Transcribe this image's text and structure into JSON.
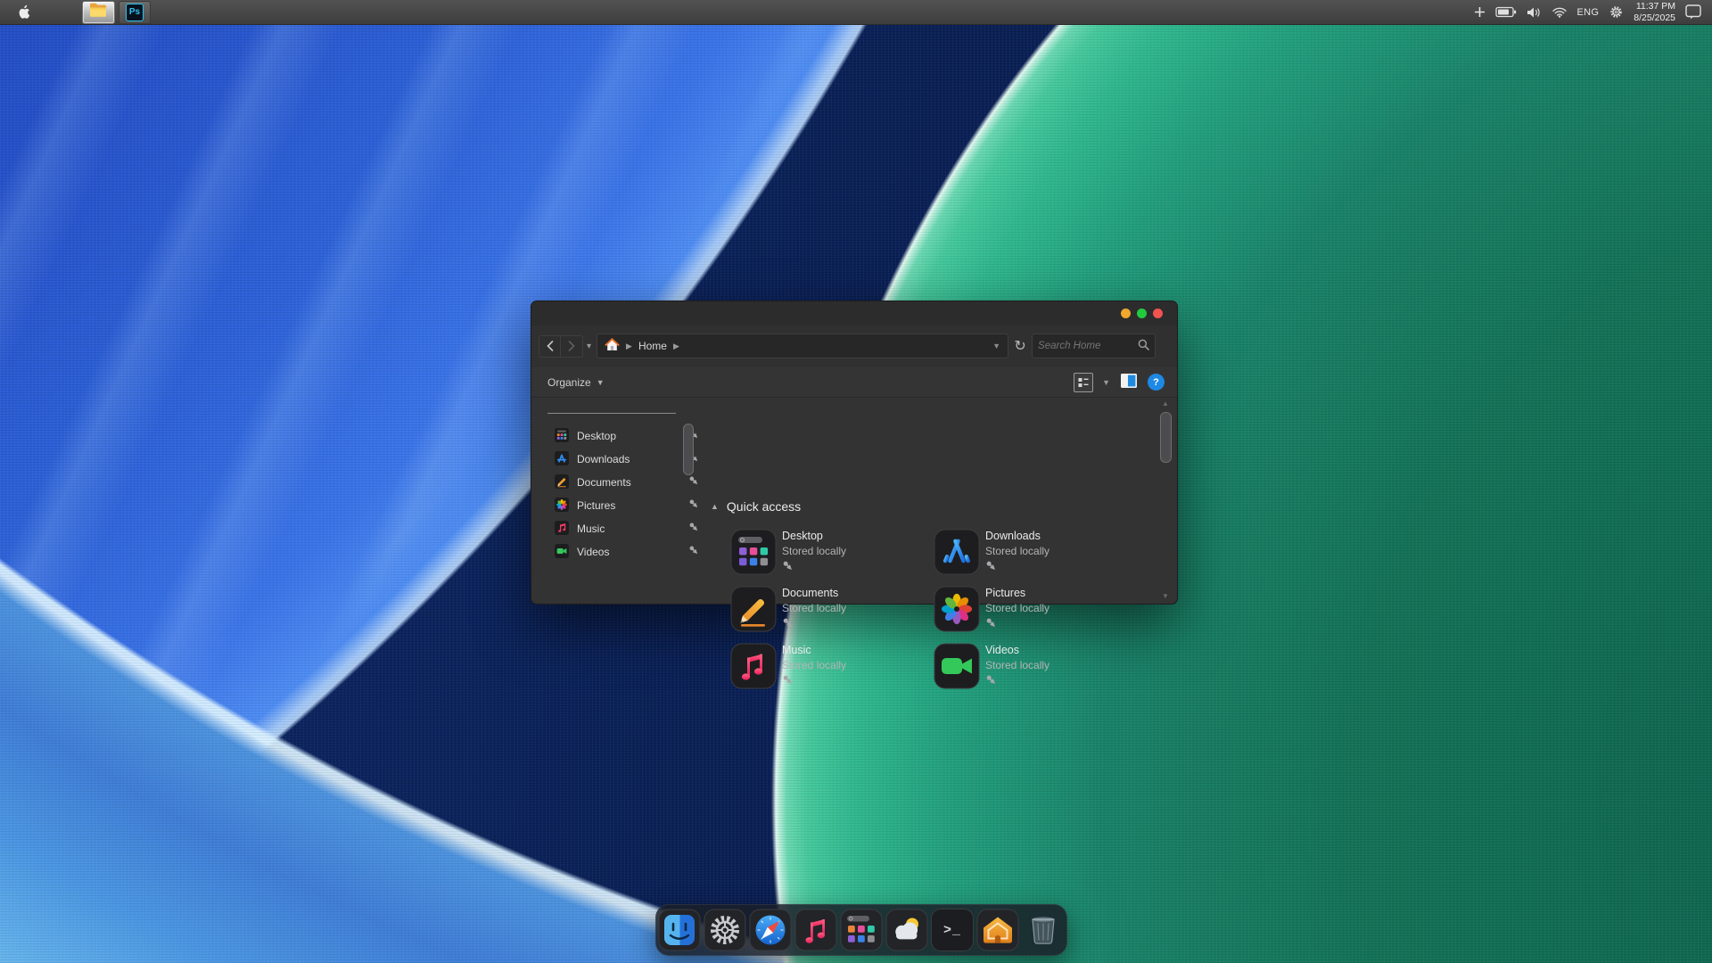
{
  "menubar": {
    "taskbar": {
      "photoshop_label": "Ps"
    },
    "status": {
      "language": "ENG",
      "time": "11:37 PM",
      "date": "8/25/2025"
    }
  },
  "window": {
    "nav": {
      "breadcrumb_root": "Home",
      "search_placeholder": "Search Home"
    },
    "toolbar": {
      "organize_label": "Organize"
    },
    "sidebar": {
      "items": [
        {
          "label": "Desktop",
          "icon": "launchpad-icon"
        },
        {
          "label": "Downloads",
          "icon": "app-store-icon"
        },
        {
          "label": "Documents",
          "icon": "pencil-icon"
        },
        {
          "label": "Pictures",
          "icon": "photos-flower-icon"
        },
        {
          "label": "Music",
          "icon": "music-note-icon"
        },
        {
          "label": "Videos",
          "icon": "video-camera-icon"
        }
      ]
    },
    "content": {
      "section_title": "Quick access",
      "tiles": [
        {
          "title": "Desktop",
          "subtitle": "Stored locally",
          "icon": "launchpad-icon"
        },
        {
          "title": "Downloads",
          "subtitle": "Stored locally",
          "icon": "app-store-icon"
        },
        {
          "title": "Documents",
          "subtitle": "Stored locally",
          "icon": "pencil-icon"
        },
        {
          "title": "Pictures",
          "subtitle": "Stored locally",
          "icon": "photos-flower-icon"
        },
        {
          "title": "Music",
          "subtitle": "Stored locally",
          "icon": "music-note-icon"
        },
        {
          "title": "Videos",
          "subtitle": "Stored locally",
          "icon": "video-camera-icon"
        }
      ]
    }
  },
  "dock": {
    "terminal_glyph": ">_",
    "items": [
      "finder",
      "system-settings",
      "safari",
      "music",
      "launchpad",
      "weather",
      "terminal",
      "home",
      "trash"
    ]
  },
  "colors": {
    "traffic_yellow": "#f0a82d",
    "traffic_green": "#22c93e",
    "traffic_red": "#f1534f",
    "help_blue": "#1e88e5",
    "accent_blue": "#2f8ef4",
    "wallpaper_green": "#2fbd92",
    "wallpaper_blue": "#2f62d8",
    "wallpaper_navy": "#0b2156"
  }
}
